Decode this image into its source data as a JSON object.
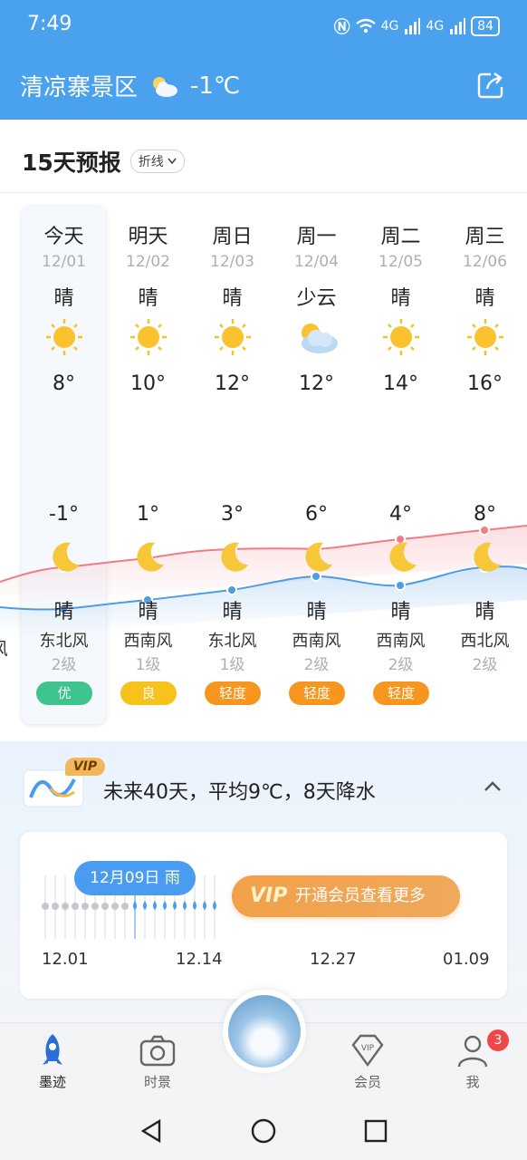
{
  "status_bar": {
    "time": "7:49",
    "network_1": "4G",
    "network_2": "4G",
    "battery": "84"
  },
  "header": {
    "location": "清凉寨景区",
    "temperature": "-1℃",
    "weather_icon": "partly-cloudy-icon",
    "share_icon": "share-icon"
  },
  "forecast": {
    "title": "15天预报",
    "mode": "折线",
    "prev_wind_fragment": "风",
    "days": [
      {
        "name": "今天",
        "date": "12/01",
        "day_cond": "晴",
        "day_icon": "sun-icon",
        "high": "8°",
        "low": "-1°",
        "night_icon": "moon-icon",
        "night_cond": "晴",
        "wind": "东北风",
        "level": "2级",
        "aqi": "优",
        "aqi_color": "#3fc48e"
      },
      {
        "name": "明天",
        "date": "12/02",
        "day_cond": "晴",
        "day_icon": "sun-icon",
        "high": "10°",
        "low": "1°",
        "night_icon": "moon-icon",
        "night_cond": "晴",
        "wind": "西南风",
        "level": "1级",
        "aqi": "良",
        "aqi_color": "#f7c21b"
      },
      {
        "name": "周日",
        "date": "12/03",
        "day_cond": "晴",
        "day_icon": "sun-icon",
        "high": "12°",
        "low": "3°",
        "night_icon": "moon-icon",
        "night_cond": "晴",
        "wind": "东北风",
        "level": "1级",
        "aqi": "轻度",
        "aqi_color": "#f7961e"
      },
      {
        "name": "周一",
        "date": "12/04",
        "day_cond": "少云",
        "day_icon": "cloud-sun-icon",
        "high": "12°",
        "low": "6°",
        "night_icon": "moon-icon",
        "night_cond": "晴",
        "wind": "西南风",
        "level": "2级",
        "aqi": "轻度",
        "aqi_color": "#f7961e"
      },
      {
        "name": "周二",
        "date": "12/05",
        "day_cond": "晴",
        "day_icon": "sun-icon",
        "high": "14°",
        "low": "4°",
        "night_icon": "moon-icon",
        "night_cond": "晴",
        "wind": "西南风",
        "level": "2级",
        "aqi": "轻度",
        "aqi_color": "#f7961e"
      },
      {
        "name": "周三",
        "date": "12/06",
        "day_cond": "晴",
        "day_icon": "sun-icon",
        "high": "16°",
        "low": "8°",
        "night_icon": "moon-icon",
        "night_cond": "晴",
        "wind": "西北风",
        "level": "2级",
        "aqi": "",
        "aqi_color": ""
      }
    ]
  },
  "trend": {
    "vip_badge": "VIP",
    "summary": "未来40天，平均9℃，8天降水",
    "bubble": "12月09日 雨",
    "vip_label": "VIP",
    "vip_button": "开通会员查看更多",
    "ticks": [
      "12.01",
      "12.14",
      "12.27",
      "01.09"
    ]
  },
  "bottom_nav": {
    "items": [
      {
        "label": "墨迹",
        "icon": "rocket-icon",
        "active": true
      },
      {
        "label": "时景",
        "icon": "camera-icon",
        "active": false
      },
      {
        "label": "会员",
        "icon": "vip-diamond-icon",
        "active": false
      },
      {
        "label": "我",
        "icon": "user-icon",
        "active": false
      }
    ],
    "badge": "3"
  },
  "colors": {
    "header_bg": "#4aa1ee",
    "high_line": "#f27c85",
    "low_line": "#4e9be6",
    "vip_orange": "#f2a14a"
  }
}
